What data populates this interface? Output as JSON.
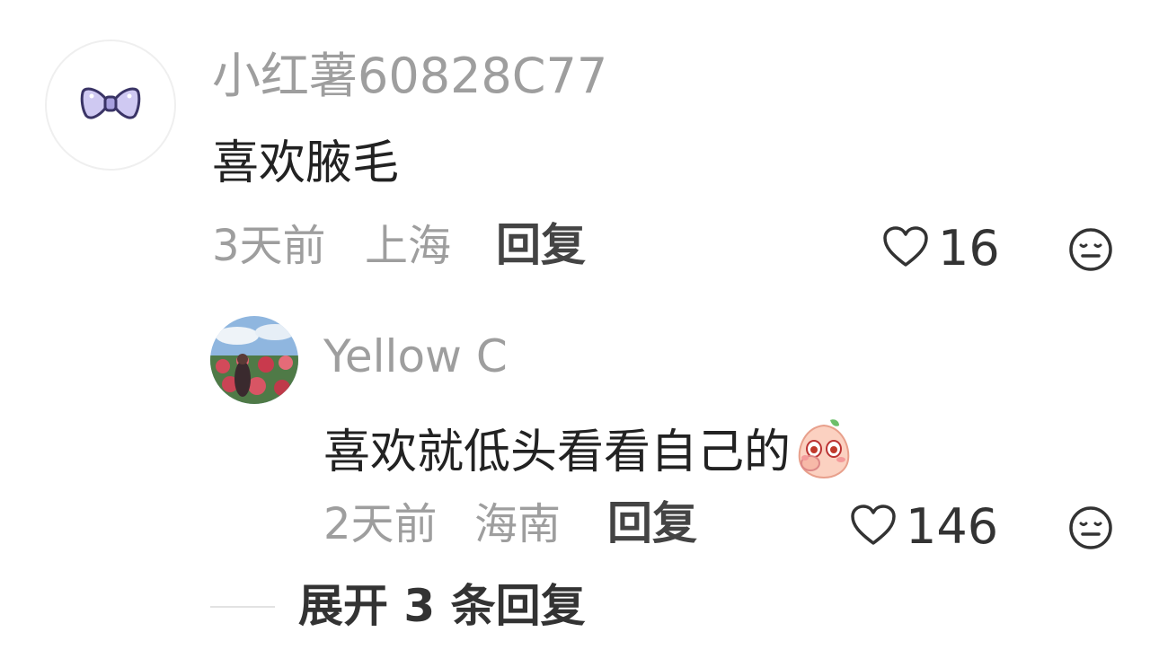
{
  "comment": {
    "username": "小红薯60828C77",
    "avatar_icon": "bow-icon",
    "content": "喜欢腋毛",
    "time": "3天前",
    "location": "上海",
    "reply_label": "回复",
    "like_icon": "heart-outline-icon",
    "like_count": "16",
    "dislike_icon": "meh-face-icon"
  },
  "reply": {
    "username": "Yellow C",
    "avatar_icon": "photo-avatar",
    "content": "喜欢就低头看看自己的",
    "emoji_icon": "peach-covering-mouth-emoji",
    "time": "2天前",
    "location": "海南",
    "reply_label": "回复",
    "like_icon": "heart-outline-icon",
    "like_count": "146",
    "dislike_icon": "meh-face-icon"
  },
  "expand": {
    "label": "展开 3 条回复"
  },
  "colors": {
    "muted_text": "#9e9e9e",
    "main_text": "#222222",
    "action_text": "#444444",
    "divider": "#e2e2e2",
    "bow": "#c9c3ee"
  }
}
